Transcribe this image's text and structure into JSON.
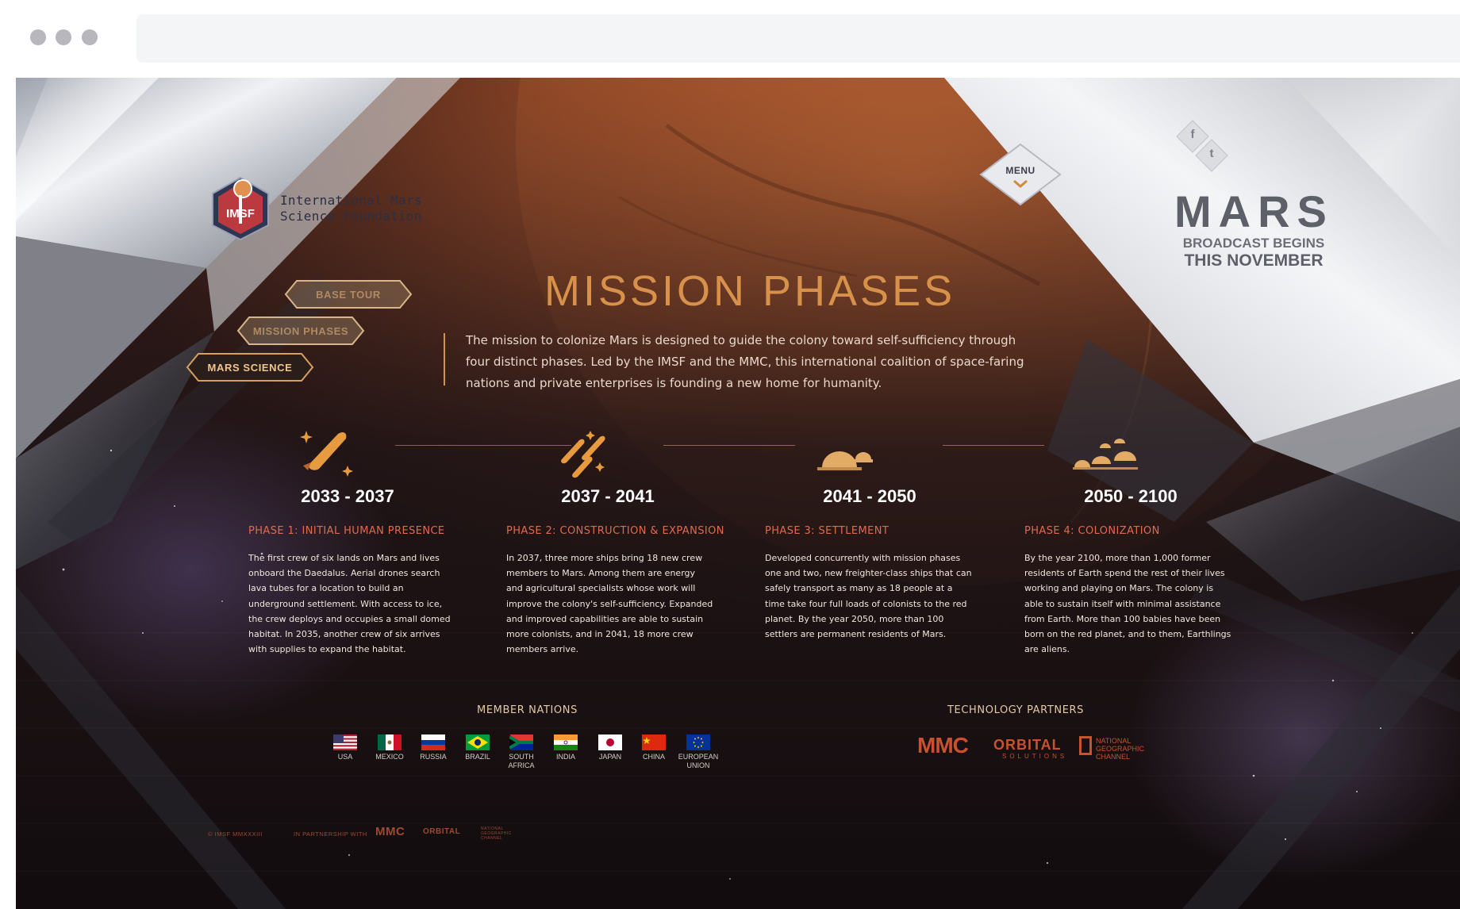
{
  "org": {
    "name_line1": "International Mars",
    "name_line2": "Science Foundation",
    "badge_text": "IMSF"
  },
  "nav": {
    "base_tour": "BASE TOUR",
    "mission_phases": "MISSION PHASES",
    "mars_science": "MARS SCIENCE",
    "active": "MARS SCIENCE"
  },
  "menu": {
    "label": "MENU"
  },
  "social": {
    "facebook": "f",
    "twitter": "t"
  },
  "promo": {
    "title": "MARS",
    "line1": "BROADCAST BEGINS",
    "line2": "THIS NOVEMBER"
  },
  "page": {
    "title": "MISSION PHASES",
    "intro": "The mission to colonize Mars is designed to guide the colony toward self-sufficiency through four distinct phases. Led by the IMSF and the MMC, this international coalition of space-faring nations and private enterprises is founding a new home for humanity."
  },
  "phases": [
    {
      "years": "2033 - 2037",
      "title": "PHASE 1: INITIAL HUMAN PRESENCE",
      "description": "The first crew of six lands on Mars and lives onboard the Daedalus. Aerial drones search lava tubes for a location to build an underground settlement. With access to ice, the crew deploys and occupies a small domed habitat. In 2035, another crew of six arrives with supplies to expand the habitat.",
      "icon": "single-ship-icon"
    },
    {
      "years": "2037 - 2041",
      "title": "PHASE 2: CONSTRUCTION & EXPANSION",
      "description": "In 2037, three more ships bring 18 new crew members to Mars. Among them are energy and agricultural specialists whose work will improve the colony's self-sufficiency. Expanded and improved capabilities are able to sustain more colonists, and in 2041, 18 more crew members arrive.",
      "icon": "three-ships-icon"
    },
    {
      "years": "2041 - 2050",
      "title": "PHASE 3: SETTLEMENT",
      "description": "Developed concurrently with mission phases one and two, new freighter-class ships that can safely transport as many as 18 people at a time take four full loads of colonists to the red planet. By the year 2050, more than 100 settlers are permanent residents of Mars.",
      "icon": "dome-habitat-icon"
    },
    {
      "years": "2050 - 2100",
      "title": "PHASE 4: COLONIZATION",
      "description": "By the year 2100, more than 1,000 former residents of Earth spend the rest of their lives working and playing on Mars. The colony is able to sustain itself with minimal assistance from Earth. More than 100 babies have been born on the red planet, and to them, Earthlings are aliens.",
      "icon": "domed-colony-icon"
    }
  ],
  "member_nations": {
    "heading": "MEMBER NATIONS",
    "items": [
      {
        "name_line1": "USA",
        "name_line2": "",
        "flag": "usa-flag-icon"
      },
      {
        "name_line1": "MEXICO",
        "name_line2": "",
        "flag": "mexico-flag-icon"
      },
      {
        "name_line1": "RUSSIA",
        "name_line2": "",
        "flag": "russia-flag-icon"
      },
      {
        "name_line1": "BRAZIL",
        "name_line2": "",
        "flag": "brazil-flag-icon"
      },
      {
        "name_line1": "SOUTH",
        "name_line2": "AFRICA",
        "flag": "south-africa-flag-icon"
      },
      {
        "name_line1": "INDIA",
        "name_line2": "",
        "flag": "india-flag-icon"
      },
      {
        "name_line1": "JAPAN",
        "name_line2": "",
        "flag": "japan-flag-icon"
      },
      {
        "name_line1": "CHINA",
        "name_line2": "",
        "flag": "china-flag-icon"
      },
      {
        "name_line1": "EUROPEAN",
        "name_line2": "UNION",
        "flag": "eu-flag-icon"
      }
    ]
  },
  "technology_partners": {
    "heading": "TECHNOLOGY PARTNERS",
    "mmc": "MMC",
    "orbital": "ORBITAL",
    "orbital_sub": "SOLUTIONS",
    "natgeo_line1": "NATIONAL",
    "natgeo_line2": "GEOGRAPHIC",
    "natgeo_line3": "CHANNEL"
  },
  "footer": {
    "copyright": "© IMSF MMXXXIII",
    "partnership": "IN PARTNERSHIP WITH",
    "mmc": "MMC",
    "orbital": "ORBITAL",
    "natgeo": "NATIONAL GEOGRAPHIC CHANNEL"
  },
  "colors": {
    "accent": "#d7914a",
    "phase_title": "#e06a50",
    "partner": "#c7532e"
  }
}
